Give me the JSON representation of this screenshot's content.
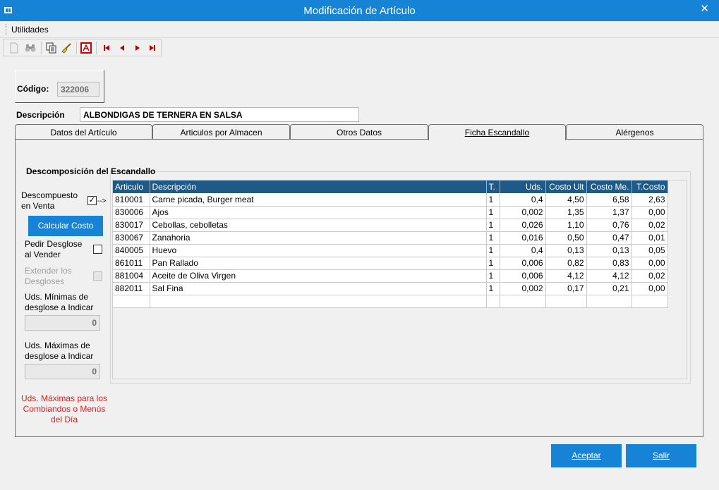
{
  "window": {
    "title": "Modificación de Artículo",
    "close_glyph": "✕"
  },
  "menu": {
    "items": [
      {
        "label": "Utilidades"
      }
    ]
  },
  "toolbar": {
    "icons": [
      "new-doc-icon",
      "binoculars-icon",
      "copy-icon",
      "broom-icon",
      "pdf-icon",
      "first-record-icon",
      "prev-record-icon",
      "next-record-icon",
      "last-record-icon"
    ]
  },
  "header": {
    "codigo_label": "Código:",
    "codigo_value": "322006",
    "descripcion_label": "Descripción",
    "descripcion_value": "ALBONDIGAS DE TERNERA EN SALSA"
  },
  "tabs": [
    {
      "label": "Datos del Artículo"
    },
    {
      "label": "Articulos por Almacen"
    },
    {
      "label": "Otros Datos"
    },
    {
      "label": "Ficha Escandallo",
      "active": true
    },
    {
      "label": "Alérgenos"
    }
  ],
  "escandallo": {
    "group_title": "Descomposición del Escandallo",
    "descompuesto_label_1": "Descompuesto",
    "descompuesto_label_2": "en Venta",
    "descompuesto_checked": true,
    "descompuesto_arrow": "-->",
    "calcular_costo": "Calcular Costo",
    "pedir_label_1": "Pedir Desglose",
    "pedir_label_2": "al Vender",
    "pedir_checked": false,
    "extender_label_1": "Extender los",
    "extender_label_2": "Desgloses",
    "min_label_1": "Uds. Mínimas de",
    "min_label_2": "desglose a Indicar",
    "min_value": "0",
    "max_label_1": "Uds. Máximas de",
    "max_label_2": "desglose a Indicar",
    "max_value": "0",
    "note_1": "Uds. Máximas para los",
    "note_2": "Combiandos o Menús",
    "note_3": "del Día"
  },
  "grid": {
    "columns": [
      "Articulo",
      "Descripción",
      "T.",
      "Uds.",
      "Costo Ult",
      "Costo Me.",
      "T.Costo"
    ],
    "rows": [
      [
        "810001",
        "Carne picada, Burger meat",
        "1",
        "0,4",
        "4,50",
        "6,58",
        "2,63"
      ],
      [
        "830006",
        "Ajos",
        "1",
        "0,002",
        "1,35",
        "1,37",
        "0,00"
      ],
      [
        "830017",
        "Cebollas, cebolletas",
        "1",
        "0,026",
        "1,10",
        "0,76",
        "0,02"
      ],
      [
        "830067",
        "Zanahoria",
        "1",
        "0,016",
        "0,50",
        "0,47",
        "0,01"
      ],
      [
        "840005",
        "Huevo",
        "1",
        "0,4",
        "0,13",
        "0,13",
        "0,05"
      ],
      [
        "861011",
        "Pan Rallado",
        "1",
        "0,006",
        "0,82",
        "0,83",
        "0,00"
      ],
      [
        "881004",
        "Aceite de Oliva Virgen",
        "1",
        "0,006",
        "4,12",
        "4,12",
        "0,02"
      ],
      [
        "882011",
        "Sal Fina",
        "1",
        "0,002",
        "0,17",
        "0,21",
        "0,00"
      ],
      [
        "",
        "",
        "",
        "",
        "",
        "",
        ""
      ]
    ]
  },
  "buttons": {
    "aceptar": "Aceptar",
    "salir": "Salir"
  },
  "colors": {
    "titlebar": "#1783d7",
    "grid_header": "#1e5a88",
    "accent_button": "#1783d7",
    "note_red": "#e02020"
  }
}
